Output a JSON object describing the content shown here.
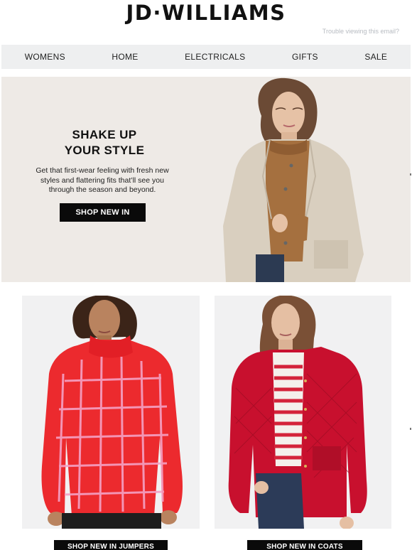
{
  "header": {
    "logo_text": "JD·WILLIAMS",
    "trouble_link": "Trouble viewing this email?"
  },
  "nav": {
    "items": [
      {
        "label": "WOMENS"
      },
      {
        "label": "HOME"
      },
      {
        "label": "ELECTRICALS"
      },
      {
        "label": "GIFTS"
      },
      {
        "label": "SALE"
      }
    ]
  },
  "hero": {
    "title_line1": "SHAKE UP",
    "title_line2": "YOUR STYLE",
    "body": "Get that first-wear feeling with fresh new styles and flattering fits that’ll see you through the season and beyond.",
    "button_label": "SHOP NEW IN"
  },
  "products": [
    {
      "button_label": "SHOP NEW IN JUMPERS"
    },
    {
      "button_label": "SHOP NEW IN COATS"
    }
  ],
  "colors": {
    "nav_bg": "#eeeff0",
    "hero_bg": "#eeeae6",
    "button_bg": "#0a0a0a",
    "jumper_red": "#e8262c",
    "coat_red": "#c8102e"
  }
}
